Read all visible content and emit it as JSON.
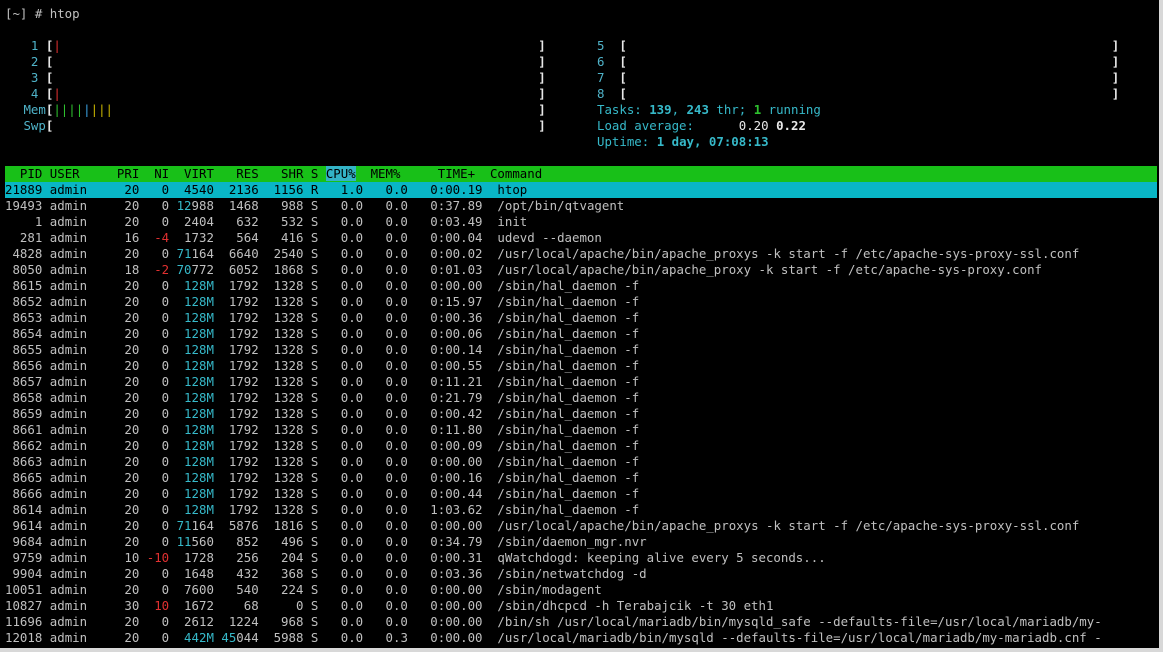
{
  "prompt": "[~] # htop",
  "cpus": [
    {
      "id": "1",
      "bar": "|"
    },
    {
      "id": "2",
      "bar": ""
    },
    {
      "id": "3",
      "bar": ""
    },
    {
      "id": "4",
      "bar": "|"
    },
    {
      "id": "5",
      "bar": ""
    },
    {
      "id": "6",
      "bar": ""
    },
    {
      "id": "7",
      "bar": ""
    },
    {
      "id": "8",
      "bar": ""
    }
  ],
  "mem": {
    "label": "Mem",
    "green": "||||",
    "blue": "|",
    "yellow": "|||"
  },
  "swp": {
    "label": "Swp"
  },
  "tasks": {
    "label": "Tasks: ",
    "count": "139",
    "sep": ", ",
    "threads": "243",
    "thr": " thr; ",
    "running": "1",
    "running_label": " running"
  },
  "load": {
    "label": "Load average: ",
    "v1": "0.20",
    "v2": "0.22"
  },
  "uptime": {
    "label": "Uptime: ",
    "value": "1 day, 07:08:13"
  },
  "columns": {
    "pid": "PID",
    "user": "USER",
    "pri": "PRI",
    "ni": "NI",
    "virt": "VIRT",
    "res": "RES",
    "shr": "SHR",
    "s": "S",
    "cpu": "CPU%",
    "mem": "MEM%",
    "time": "TIME+",
    "command": "Command"
  },
  "processes": [
    {
      "pid": "21889",
      "user": "admin",
      "pri": "20",
      "ni": "0",
      "virt": "4540",
      "res": "2136",
      "shr": "1156",
      "s": "R",
      "cpu": "1.0",
      "mem": "0.0",
      "time": "0:00.19",
      "command": "htop"
    },
    {
      "pid": "19493",
      "user": "admin",
      "pri": "20",
      "ni": "0",
      "virt": "12988",
      "res": "1468",
      "shr": "988",
      "s": "S",
      "cpu": "0.0",
      "mem": "0.0",
      "time": "0:37.89",
      "command": "/opt/bin/qtvagent"
    },
    {
      "pid": "1",
      "user": "admin",
      "pri": "20",
      "ni": "0",
      "virt": "2404",
      "res": "632",
      "shr": "532",
      "s": "S",
      "cpu": "0.0",
      "mem": "0.0",
      "time": "0:03.49",
      "command": "init"
    },
    {
      "pid": "281",
      "user": "admin",
      "pri": "16",
      "ni": "-4",
      "virt": "1732",
      "res": "564",
      "shr": "416",
      "s": "S",
      "cpu": "0.0",
      "mem": "0.0",
      "time": "0:00.04",
      "command": "udevd --daemon"
    },
    {
      "pid": "4828",
      "user": "admin",
      "pri": "20",
      "ni": "0",
      "virt": "71164",
      "res": "6640",
      "shr": "2540",
      "s": "S",
      "cpu": "0.0",
      "mem": "0.0",
      "time": "0:00.02",
      "command": "/usr/local/apache/bin/apache_proxys -k start -f /etc/apache-sys-proxy-ssl.conf"
    },
    {
      "pid": "8050",
      "user": "admin",
      "pri": "18",
      "ni": "-2",
      "virt": "70772",
      "res": "6052",
      "shr": "1868",
      "s": "S",
      "cpu": "0.0",
      "mem": "0.0",
      "time": "0:01.03",
      "command": "/usr/local/apache/bin/apache_proxy -k start -f /etc/apache-sys-proxy.conf"
    },
    {
      "pid": "8615",
      "user": "admin",
      "pri": "20",
      "ni": "0",
      "virt": "128M",
      "res": "1792",
      "shr": "1328",
      "s": "S",
      "cpu": "0.0",
      "mem": "0.0",
      "time": "0:00.00",
      "command": "/sbin/hal_daemon -f"
    },
    {
      "pid": "8652",
      "user": "admin",
      "pri": "20",
      "ni": "0",
      "virt": "128M",
      "res": "1792",
      "shr": "1328",
      "s": "S",
      "cpu": "0.0",
      "mem": "0.0",
      "time": "0:15.97",
      "command": "/sbin/hal_daemon -f"
    },
    {
      "pid": "8653",
      "user": "admin",
      "pri": "20",
      "ni": "0",
      "virt": "128M",
      "res": "1792",
      "shr": "1328",
      "s": "S",
      "cpu": "0.0",
      "mem": "0.0",
      "time": "0:00.36",
      "command": "/sbin/hal_daemon -f"
    },
    {
      "pid": "8654",
      "user": "admin",
      "pri": "20",
      "ni": "0",
      "virt": "128M",
      "res": "1792",
      "shr": "1328",
      "s": "S",
      "cpu": "0.0",
      "mem": "0.0",
      "time": "0:00.06",
      "command": "/sbin/hal_daemon -f"
    },
    {
      "pid": "8655",
      "user": "admin",
      "pri": "20",
      "ni": "0",
      "virt": "128M",
      "res": "1792",
      "shr": "1328",
      "s": "S",
      "cpu": "0.0",
      "mem": "0.0",
      "time": "0:00.14",
      "command": "/sbin/hal_daemon -f"
    },
    {
      "pid": "8656",
      "user": "admin",
      "pri": "20",
      "ni": "0",
      "virt": "128M",
      "res": "1792",
      "shr": "1328",
      "s": "S",
      "cpu": "0.0",
      "mem": "0.0",
      "time": "0:00.55",
      "command": "/sbin/hal_daemon -f"
    },
    {
      "pid": "8657",
      "user": "admin",
      "pri": "20",
      "ni": "0",
      "virt": "128M",
      "res": "1792",
      "shr": "1328",
      "s": "S",
      "cpu": "0.0",
      "mem": "0.0",
      "time": "0:11.21",
      "command": "/sbin/hal_daemon -f"
    },
    {
      "pid": "8658",
      "user": "admin",
      "pri": "20",
      "ni": "0",
      "virt": "128M",
      "res": "1792",
      "shr": "1328",
      "s": "S",
      "cpu": "0.0",
      "mem": "0.0",
      "time": "0:21.79",
      "command": "/sbin/hal_daemon -f"
    },
    {
      "pid": "8659",
      "user": "admin",
      "pri": "20",
      "ni": "0",
      "virt": "128M",
      "res": "1792",
      "shr": "1328",
      "s": "S",
      "cpu": "0.0",
      "mem": "0.0",
      "time": "0:00.42",
      "command": "/sbin/hal_daemon -f"
    },
    {
      "pid": "8661",
      "user": "admin",
      "pri": "20",
      "ni": "0",
      "virt": "128M",
      "res": "1792",
      "shr": "1328",
      "s": "S",
      "cpu": "0.0",
      "mem": "0.0",
      "time": "0:11.80",
      "command": "/sbin/hal_daemon -f"
    },
    {
      "pid": "8662",
      "user": "admin",
      "pri": "20",
      "ni": "0",
      "virt": "128M",
      "res": "1792",
      "shr": "1328",
      "s": "S",
      "cpu": "0.0",
      "mem": "0.0",
      "time": "0:00.09",
      "command": "/sbin/hal_daemon -f"
    },
    {
      "pid": "8663",
      "user": "admin",
      "pri": "20",
      "ni": "0",
      "virt": "128M",
      "res": "1792",
      "shr": "1328",
      "s": "S",
      "cpu": "0.0",
      "mem": "0.0",
      "time": "0:00.00",
      "command": "/sbin/hal_daemon -f"
    },
    {
      "pid": "8665",
      "user": "admin",
      "pri": "20",
      "ni": "0",
      "virt": "128M",
      "res": "1792",
      "shr": "1328",
      "s": "S",
      "cpu": "0.0",
      "mem": "0.0",
      "time": "0:00.16",
      "command": "/sbin/hal_daemon -f"
    },
    {
      "pid": "8666",
      "user": "admin",
      "pri": "20",
      "ni": "0",
      "virt": "128M",
      "res": "1792",
      "shr": "1328",
      "s": "S",
      "cpu": "0.0",
      "mem": "0.0",
      "time": "0:00.44",
      "command": "/sbin/hal_daemon -f"
    },
    {
      "pid": "8614",
      "user": "admin",
      "pri": "20",
      "ni": "0",
      "virt": "128M",
      "res": "1792",
      "shr": "1328",
      "s": "S",
      "cpu": "0.0",
      "mem": "0.0",
      "time": "1:03.62",
      "command": "/sbin/hal_daemon -f"
    },
    {
      "pid": "9614",
      "user": "admin",
      "pri": "20",
      "ni": "0",
      "virt": "71164",
      "res": "5876",
      "shr": "1816",
      "s": "S",
      "cpu": "0.0",
      "mem": "0.0",
      "time": "0:00.00",
      "command": "/usr/local/apache/bin/apache_proxys -k start -f /etc/apache-sys-proxy-ssl.conf"
    },
    {
      "pid": "9684",
      "user": "admin",
      "pri": "20",
      "ni": "0",
      "virt": "11560",
      "res": "852",
      "shr": "496",
      "s": "S",
      "cpu": "0.0",
      "mem": "0.0",
      "time": "0:34.79",
      "command": "/sbin/daemon_mgr.nvr"
    },
    {
      "pid": "9759",
      "user": "admin",
      "pri": "10",
      "ni": "-10",
      "virt": "1728",
      "res": "256",
      "shr": "204",
      "s": "S",
      "cpu": "0.0",
      "mem": "0.0",
      "time": "0:00.31",
      "command": "qWatchdogd: keeping alive every 5 seconds..."
    },
    {
      "pid": "9904",
      "user": "admin",
      "pri": "20",
      "ni": "0",
      "virt": "1648",
      "res": "432",
      "shr": "368",
      "s": "S",
      "cpu": "0.0",
      "mem": "0.0",
      "time": "0:03.36",
      "command": "/sbin/netwatchdog -d"
    },
    {
      "pid": "10051",
      "user": "admin",
      "pri": "20",
      "ni": "0",
      "virt": "7600",
      "res": "540",
      "shr": "224",
      "s": "S",
      "cpu": "0.0",
      "mem": "0.0",
      "time": "0:00.00",
      "command": "/sbin/modagent"
    },
    {
      "pid": "10827",
      "user": "admin",
      "pri": "30",
      "ni": "10",
      "virt": "1672",
      "res": "68",
      "shr": "0",
      "s": "S",
      "cpu": "0.0",
      "mem": "0.0",
      "time": "0:00.00",
      "command": "/sbin/dhcpcd -h Terabajcik -t 30 eth1"
    },
    {
      "pid": "11696",
      "user": "admin",
      "pri": "20",
      "ni": "0",
      "virt": "2612",
      "res": "1224",
      "shr": "968",
      "s": "S",
      "cpu": "0.0",
      "mem": "0.0",
      "time": "0:00.00",
      "command": "/bin/sh /usr/local/mariadb/bin/mysqld_safe --defaults-file=/usr/local/mariadb/my-"
    },
    {
      "pid": "12018",
      "user": "admin",
      "pri": "20",
      "ni": "0",
      "virt": "442M",
      "res": "45044",
      "shr": "5988",
      "s": "S",
      "cpu": "0.0",
      "mem": "0.3",
      "time": "0:00.00",
      "command": "/usr/local/mariadb/bin/mysqld --defaults-file=/usr/local/mariadb/my-mariadb.cnf -"
    }
  ]
}
